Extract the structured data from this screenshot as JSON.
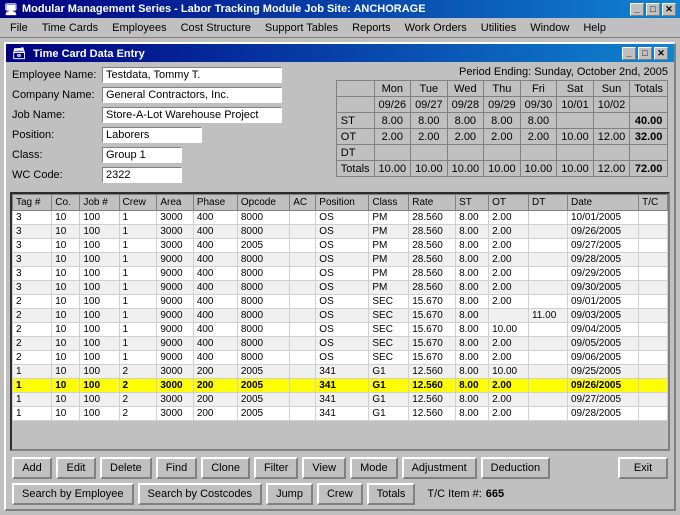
{
  "title_bar": {
    "text": "Modular Management Series - Labor Tracking Module    Job Site: ANCHORAGE",
    "icon": "app-icon"
  },
  "menu": {
    "items": [
      "File",
      "Time Cards",
      "Employees",
      "Cost Structure",
      "Support Tables",
      "Reports",
      "Work Orders",
      "Utilities",
      "Window",
      "Help"
    ]
  },
  "inner_window": {
    "title": "Time Card Data Entry"
  },
  "form": {
    "employee_label": "Employee Name:",
    "employee_value": "Testdata, Tommy T.",
    "company_label": "Company Name:",
    "company_value": "General Contractors, Inc.",
    "job_label": "Job Name:",
    "job_value": "Store-A-Lot Warehouse Project",
    "position_label": "Position:",
    "position_value": "Laborers",
    "class_label": "Class:",
    "class_value": "Group 1",
    "wc_label": "WC Code:",
    "wc_value": "2322",
    "period_label": "Period Ending: Sunday, October 2nd, 2005"
  },
  "time_summary": {
    "headers": [
      "Mon",
      "Tue",
      "Wed",
      "Thu",
      "Fri",
      "Sat",
      "Sun",
      "Totals"
    ],
    "dates": [
      "09/26",
      "09/27",
      "09/28",
      "09/29",
      "09/30",
      "10/01",
      "10/02"
    ],
    "rows": [
      {
        "label": "ST",
        "values": [
          "8.00",
          "8.00",
          "8.00",
          "8.00",
          "8.00",
          "",
          "",
          "40.00"
        ]
      },
      {
        "label": "OT",
        "values": [
          "2.00",
          "2.00",
          "2.00",
          "2.00",
          "2.00",
          "10.00",
          "12.00",
          "32.00"
        ]
      },
      {
        "label": "DT",
        "values": [
          "",
          "",
          "",
          "",
          "",
          "",
          "",
          ""
        ]
      },
      {
        "label": "Totals",
        "values": [
          "10.00",
          "10.00",
          "10.00",
          "10.00",
          "10.00",
          "10.00",
          "12.00",
          "72.00"
        ]
      }
    ]
  },
  "grid": {
    "headers": [
      "Tag #",
      "Co.",
      "Job #",
      "Crew",
      "Area",
      "Phase",
      "Opcode",
      "AC",
      "Position",
      "Class",
      "Rate",
      "ST",
      "OT",
      "DT",
      "Date",
      "T/C"
    ],
    "rows": [
      {
        "tag": "3",
        "co": "10",
        "job": "100",
        "crew": "1",
        "area": "3000",
        "phase": "400",
        "opcode": "8000",
        "ac": "",
        "pos": "OS",
        "class": "PM",
        "rate": "28.560",
        "st": "8.00",
        "ot": "2.00",
        "dt": "",
        "date": "10/01/2005",
        "tc": "",
        "highlight": false
      },
      {
        "tag": "3",
        "co": "10",
        "job": "100",
        "crew": "1",
        "area": "3000",
        "phase": "400",
        "opcode": "8000",
        "ac": "",
        "pos": "OS",
        "class": "PM",
        "rate": "28.560",
        "st": "8.00",
        "ot": "2.00",
        "dt": "",
        "date": "09/26/2005",
        "tc": "",
        "highlight": false
      },
      {
        "tag": "3",
        "co": "10",
        "job": "100",
        "crew": "1",
        "area": "3000",
        "phase": "400",
        "opcode": "2005",
        "ac": "",
        "pos": "OS",
        "class": "PM",
        "rate": "28.560",
        "st": "8.00",
        "ot": "2.00",
        "dt": "",
        "date": "09/27/2005",
        "tc": "",
        "highlight": false
      },
      {
        "tag": "3",
        "co": "10",
        "job": "100",
        "crew": "1",
        "area": "9000",
        "phase": "400",
        "opcode": "8000",
        "ac": "",
        "pos": "OS",
        "class": "PM",
        "rate": "28.560",
        "st": "8.00",
        "ot": "2.00",
        "dt": "",
        "date": "09/28/2005",
        "tc": "",
        "highlight": false
      },
      {
        "tag": "3",
        "co": "10",
        "job": "100",
        "crew": "1",
        "area": "9000",
        "phase": "400",
        "opcode": "8000",
        "ac": "",
        "pos": "OS",
        "class": "PM",
        "rate": "28.560",
        "st": "8.00",
        "ot": "2.00",
        "dt": "",
        "date": "09/29/2005",
        "tc": "",
        "highlight": false
      },
      {
        "tag": "3",
        "co": "10",
        "job": "100",
        "crew": "1",
        "area": "9000",
        "phase": "400",
        "opcode": "8000",
        "ac": "",
        "pos": "OS",
        "class": "PM",
        "rate": "28.560",
        "st": "8.00",
        "ot": "2.00",
        "dt": "",
        "date": "09/30/2005",
        "tc": "",
        "highlight": false
      },
      {
        "tag": "2",
        "co": "10",
        "job": "100",
        "crew": "1",
        "area": "9000",
        "phase": "400",
        "opcode": "8000",
        "ac": "",
        "pos": "OS",
        "class": "SEC",
        "rate": "15.670",
        "st": "8.00",
        "ot": "2.00",
        "dt": "",
        "date": "09/01/2005",
        "tc": "",
        "highlight": false
      },
      {
        "tag": "2",
        "co": "10",
        "job": "100",
        "crew": "1",
        "area": "9000",
        "phase": "400",
        "opcode": "8000",
        "ac": "",
        "pos": "OS",
        "class": "SEC",
        "rate": "15.670",
        "st": "8.00",
        "ot": "",
        "dt": "11.00",
        "date": "09/03/2005",
        "tc": "",
        "highlight": false
      },
      {
        "tag": "2",
        "co": "10",
        "job": "100",
        "crew": "1",
        "area": "9000",
        "phase": "400",
        "opcode": "8000",
        "ac": "",
        "pos": "OS",
        "class": "SEC",
        "rate": "15.670",
        "st": "8.00",
        "ot": "10.00",
        "dt": "",
        "date": "09/04/2005",
        "tc": "",
        "highlight": false
      },
      {
        "tag": "2",
        "co": "10",
        "job": "100",
        "crew": "1",
        "area": "9000",
        "phase": "400",
        "opcode": "8000",
        "ac": "",
        "pos": "OS",
        "class": "SEC",
        "rate": "15.670",
        "st": "8.00",
        "ot": "2.00",
        "dt": "",
        "date": "09/05/2005",
        "tc": "",
        "highlight": false
      },
      {
        "tag": "2",
        "co": "10",
        "job": "100",
        "crew": "1",
        "area": "9000",
        "phase": "400",
        "opcode": "8000",
        "ac": "",
        "pos": "OS",
        "class": "SEC",
        "rate": "15.670",
        "st": "8.00",
        "ot": "2.00",
        "dt": "",
        "date": "09/06/2005",
        "tc": "",
        "highlight": false
      },
      {
        "tag": "1",
        "co": "10",
        "job": "100",
        "crew": "2",
        "area": "3000",
        "phase": "200",
        "opcode": "2005",
        "ac": "",
        "pos": "341",
        "class": "G1",
        "rate": "12.560",
        "st": "8.00",
        "ot": "10.00",
        "dt": "",
        "date": "09/25/2005",
        "tc": "",
        "highlight": false
      },
      {
        "tag": "1",
        "co": "10",
        "job": "100",
        "crew": "2",
        "area": "3000",
        "phase": "200",
        "opcode": "2005",
        "ac": "",
        "pos": "341",
        "class": "G1",
        "rate": "12.560",
        "st": "8.00",
        "ot": "2.00",
        "dt": "",
        "date": "09/26/2005",
        "tc": "",
        "highlight": true
      },
      {
        "tag": "1",
        "co": "10",
        "job": "100",
        "crew": "2",
        "area": "3000",
        "phase": "200",
        "opcode": "2005",
        "ac": "",
        "pos": "341",
        "class": "G1",
        "rate": "12.560",
        "st": "8.00",
        "ot": "2.00",
        "dt": "",
        "date": "09/27/2005",
        "tc": "",
        "highlight": false
      },
      {
        "tag": "1",
        "co": "10",
        "job": "100",
        "crew": "2",
        "area": "3000",
        "phase": "200",
        "opcode": "2005",
        "ac": "",
        "pos": "341",
        "class": "G1",
        "rate": "12.560",
        "st": "8.00",
        "ot": "2.00",
        "dt": "",
        "date": "09/28/2005",
        "tc": "",
        "highlight": false
      }
    ]
  },
  "bottom_buttons_row1": [
    "Add",
    "Edit",
    "Delete",
    "Find",
    "Clone",
    "Filter",
    "View",
    "Mode",
    "Adjustment",
    "Deduction"
  ],
  "bottom_buttons_row2": [
    "Search by Employee",
    "Search by Costcodes",
    "Jump",
    "Crew",
    "Totals"
  ],
  "exit_button": "Exit",
  "tc_item_label": "T/C Item #:",
  "tc_item_value": "665"
}
